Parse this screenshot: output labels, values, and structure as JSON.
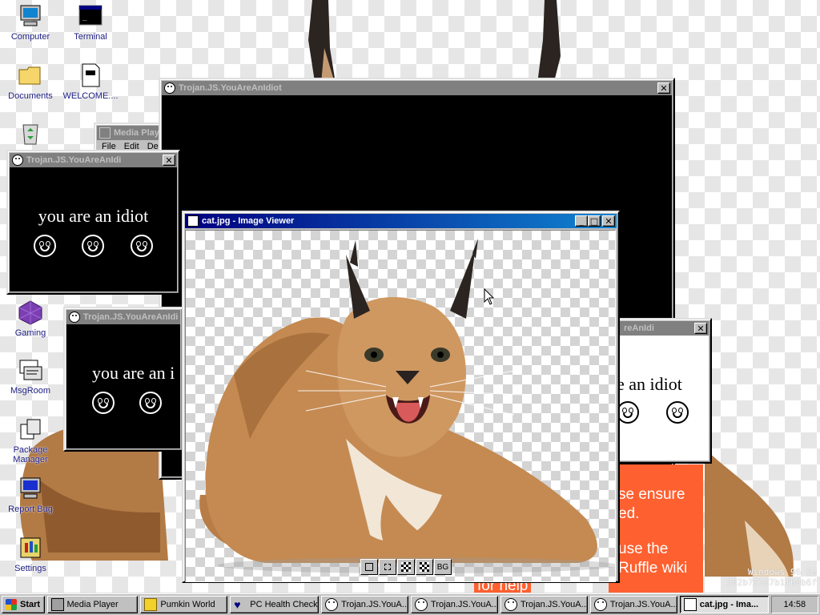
{
  "desktop": {
    "icons": [
      {
        "label": "Computer",
        "icon": "computer-icon"
      },
      {
        "label": "Terminal",
        "icon": "terminal-icon"
      },
      {
        "label": "Documents",
        "icon": "folder-icon"
      },
      {
        "label": "WELCOME....",
        "icon": "document-icon"
      },
      {
        "label": "",
        "icon": "recycle-bin-icon"
      },
      {
        "label": "Gaming",
        "icon": "gaming-icon"
      },
      {
        "label": "MsgRoom",
        "icon": "msgroom-icon"
      },
      {
        "label": "Package Manager",
        "icon": "package-manager-icon"
      },
      {
        "label": "Report Bug",
        "icon": "report-bug-icon"
      },
      {
        "label": "Settings",
        "icon": "settings-icon"
      }
    ],
    "watermark": [
      "Windows 96 Se",
      "582b75107b1fb8b6f"
    ],
    "orange_panel_lines": [
      "se ensure",
      "ed.",
      "use the",
      "Ruffle wiki",
      "for help"
    ]
  },
  "windows": {
    "big_black": {
      "title": "Trojan.JS.YouAreAnIdiot"
    },
    "media_player": {
      "title": "Media Play",
      "menu": [
        "File",
        "Edit",
        "Dev"
      ]
    },
    "idiot1": {
      "title": "Trojan.JS.YouAreAnIdi",
      "text": "you are an idiot"
    },
    "idiot2": {
      "title": "Trojan.JS.YouAreAnIdiot",
      "text": "you are an i"
    },
    "idiot3": {
      "title": "reAnIdi",
      "text": "e an idiot"
    },
    "viewer": {
      "title": "cat.jpg - Image Viewer",
      "tools": [
        "fit-icon",
        "actual-size-icon",
        "checker-icon",
        "checker-alt-icon",
        "BG"
      ],
      "bg_label": "BG"
    }
  },
  "taskbar": {
    "start": "Start",
    "items": [
      {
        "label": "Media Player",
        "icon": "media-player-icon"
      },
      {
        "label": "Pumkin World",
        "icon": "pumkin-world-icon"
      },
      {
        "label": "PC Health Check",
        "icon": "heart-icon"
      },
      {
        "label": "Trojan.JS.YouA...",
        "icon": "smiley-icon"
      },
      {
        "label": "Trojan.JS.YouA...",
        "icon": "smiley-icon"
      },
      {
        "label": "Trojan.JS.YouA...",
        "icon": "smiley-icon"
      },
      {
        "label": "Trojan.JS.YouA...",
        "icon": "smiley-icon"
      },
      {
        "label": "cat.jpg - Ima...",
        "icon": "image-viewer-icon"
      }
    ],
    "clock": "14:58"
  },
  "colors": {
    "titlebar_active": "#000080",
    "titlebar_inactive": "#808080",
    "orange": "#ff6030"
  }
}
